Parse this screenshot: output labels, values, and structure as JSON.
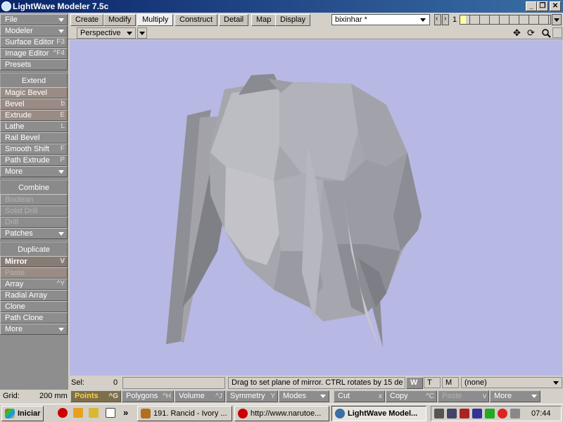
{
  "window": {
    "title": "LightWave Modeler 7.5c",
    "minimize": "_",
    "restore": "❐",
    "close": "✕"
  },
  "sidebar": {
    "file": "File",
    "modeler": "Modeler",
    "surface_editor": {
      "label": "Surface Editor",
      "shortcut": "F3"
    },
    "image_editor": {
      "label": "Image Editor",
      "shortcut": "^F4"
    },
    "presets": "Presets",
    "extend_header": "Extend",
    "magic_bevel": "Magic Bevel",
    "bevel": {
      "label": "Bevel",
      "shortcut": "b"
    },
    "extrude": {
      "label": "Extrude",
      "shortcut": "E"
    },
    "lathe": {
      "label": "Lathe",
      "shortcut": "L"
    },
    "rail_bevel": "Rail Bevel",
    "smooth_shift": {
      "label": "Smooth Shift",
      "shortcut": "F"
    },
    "path_extrude": {
      "label": "Path Extrude",
      "shortcut": "P"
    },
    "more1": "More",
    "combine_header": "Combine",
    "boolean": "Boolean",
    "solid_drill": "Solid Drill",
    "drill": "Drill",
    "patches": "Patches",
    "duplicate_header": "Duplicate",
    "mirror": {
      "label": "Mirror",
      "shortcut": "V"
    },
    "paste": "Paste",
    "array": {
      "label": "Array",
      "shortcut": "^Y"
    },
    "radial_array": "Radial Array",
    "clone": "Clone",
    "path_clone": "Path Clone",
    "more2": "More"
  },
  "tabs": [
    "Create",
    "Modify",
    "Multiply",
    "Construct",
    "Detail",
    "Map",
    "Display"
  ],
  "object_name": "bixinhar *",
  "layer_number": "1",
  "view": {
    "mode": "Perspective"
  },
  "status": {
    "sel_label": "Sel:",
    "sel_value": "0",
    "message": "Drag to set plane of mirror. CTRL rotates by 15 de ...",
    "w": "W",
    "t": "T",
    "m": "M",
    "surface": "(none)"
  },
  "bottom": {
    "grid_label": "Grid:",
    "grid_value": "200 mm",
    "points": {
      "label": "Points",
      "shortcut": "^G"
    },
    "polygons": {
      "label": "Polygons",
      "shortcut": "^H"
    },
    "volume": {
      "label": "Volume",
      "shortcut": "^J"
    },
    "symmetry": {
      "label": "Symmetry",
      "shortcut": "Y"
    },
    "modes": "Modes",
    "cut": {
      "label": "Cut",
      "shortcut": "x"
    },
    "copy": {
      "label": "Copy",
      "shortcut": "^C"
    },
    "paste": {
      "label": "Paste",
      "shortcut": "v"
    },
    "more": "More"
  },
  "taskbar": {
    "start": "Iniciar",
    "more_arrow": "»",
    "tasks": [
      "191. Rancid - Ivory ...",
      "http://www.narutoe...",
      "LightWave Model..."
    ],
    "clock": "07:44"
  },
  "colors": {
    "viewport_bg": "#b8b8e4",
    "model_light": "#c4c4c4",
    "model_dark": "#8e8e96",
    "titlebar": "#0a246a"
  }
}
